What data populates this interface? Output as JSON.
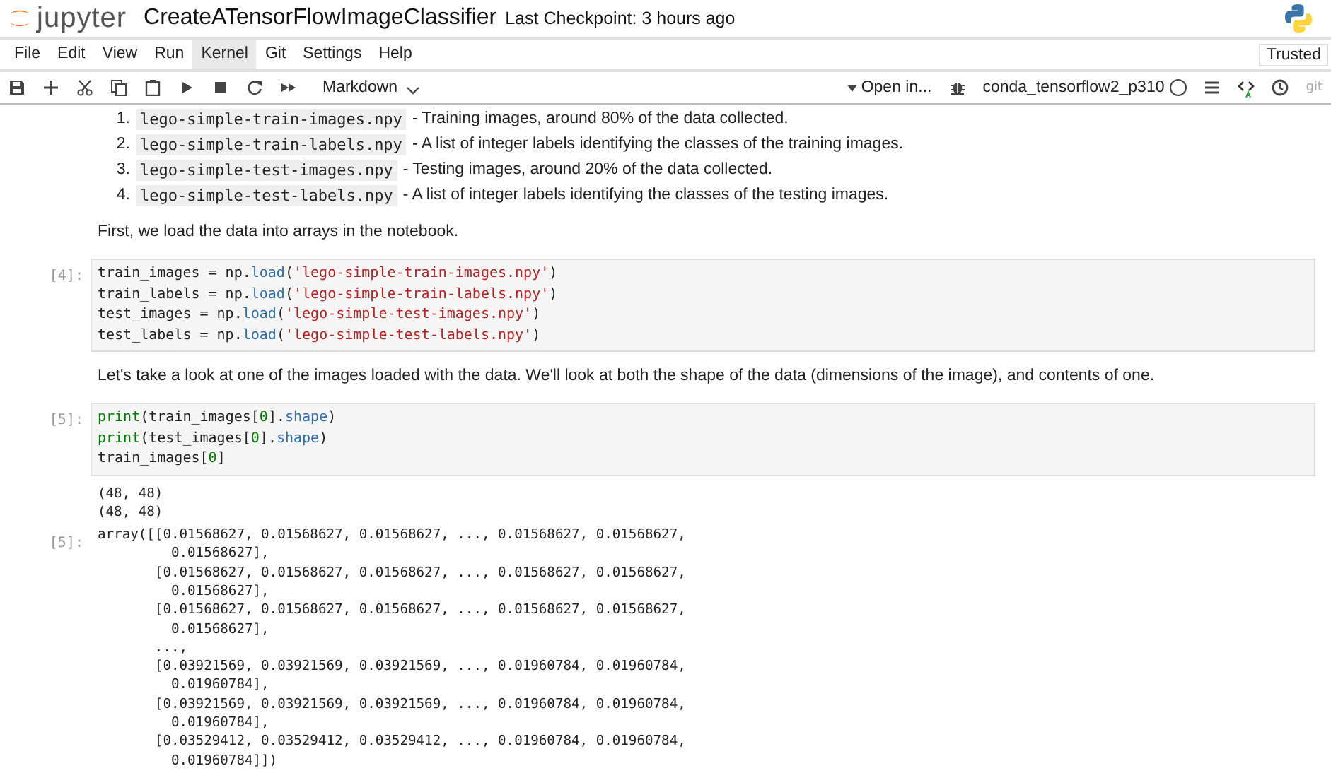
{
  "header": {
    "logo_text": "jupyter",
    "notebook_title": "CreateATensorFlowImageClassifier",
    "checkpoint": "Last Checkpoint: 3 hours ago"
  },
  "menu": [
    {
      "label": "File",
      "selected": false
    },
    {
      "label": "Edit",
      "selected": false
    },
    {
      "label": "View",
      "selected": false
    },
    {
      "label": "Run",
      "selected": false
    },
    {
      "label": "Kernel",
      "selected": true
    },
    {
      "label": "Git",
      "selected": false
    },
    {
      "label": "Settings",
      "selected": false
    },
    {
      "label": "Help",
      "selected": false
    }
  ],
  "trusted": "Trusted",
  "toolbar": {
    "cell_type": "Markdown",
    "open_in": "Open in...",
    "kernel": "conda_tensorflow2_p310",
    "kernel_busy": false,
    "git": "git"
  },
  "cells": [
    {
      "kind": "list",
      "items": [
        {
          "number": "1.",
          "code": "lego-simple-train-images.npy",
          "text": "- Training images, around 80% of the data collected."
        },
        {
          "number": "2.",
          "code": "lego-simple-train-labels.npy",
          "text": "- A list of integer labels identifying the classes of the training images."
        },
        {
          "number": "3.",
          "code": "lego-simple-test-images.npy",
          "text": "- Testing images, around 20% of the data collected."
        },
        {
          "number": "4.",
          "code": "lego-simple-test-labels.npy",
          "text": "- A list of integer labels identifying the classes of the testing images."
        }
      ]
    },
    {
      "kind": "paragraph",
      "text": "First, we load the data into arrays in the notebook."
    },
    {
      "kind": "code",
      "prompt": "[4]:",
      "lines": [
        [
          {
            "kind": "plain",
            "text": "train_images = np."
          },
          {
            "kind": "attr",
            "text": "load"
          },
          {
            "kind": "plain",
            "text": "("
          },
          {
            "kind": "string",
            "text": "'lego-simple-train-images.npy'"
          },
          {
            "kind": "plain",
            "text": ")"
          }
        ],
        [
          {
            "kind": "plain",
            "text": "train_labels = np."
          },
          {
            "kind": "attr",
            "text": "load"
          },
          {
            "kind": "plain",
            "text": "("
          },
          {
            "kind": "string",
            "text": "'lego-simple-train-labels.npy'"
          },
          {
            "kind": "plain",
            "text": ")"
          }
        ],
        [
          {
            "kind": "plain",
            "text": "test_images = np."
          },
          {
            "kind": "attr",
            "text": "load"
          },
          {
            "kind": "plain",
            "text": "("
          },
          {
            "kind": "string",
            "text": "'lego-simple-test-images.npy'"
          },
          {
            "kind": "plain",
            "text": ")"
          }
        ],
        [
          {
            "kind": "plain",
            "text": "test_labels = np."
          },
          {
            "kind": "attr",
            "text": "load"
          },
          {
            "kind": "plain",
            "text": "("
          },
          {
            "kind": "string",
            "text": "'lego-simple-test-labels.npy'"
          },
          {
            "kind": "plain",
            "text": ")"
          }
        ]
      ]
    },
    {
      "kind": "paragraph",
      "text": "Let's take a look at one of the images loaded with the data. We'll look at both the shape of the data (dimensions of the image), and contents of one."
    },
    {
      "kind": "code",
      "prompt": "[5]:",
      "lines": [
        [
          {
            "kind": "builtin",
            "text": "print"
          },
          {
            "kind": "plain",
            "text": "(train_images["
          },
          {
            "kind": "number",
            "text": "0"
          },
          {
            "kind": "plain",
            "text": "]."
          },
          {
            "kind": "attr",
            "text": "shape"
          },
          {
            "kind": "plain",
            "text": ")"
          }
        ],
        [
          {
            "kind": "builtin",
            "text": "print"
          },
          {
            "kind": "plain",
            "text": "(test_images["
          },
          {
            "kind": "number",
            "text": "0"
          },
          {
            "kind": "plain",
            "text": "]."
          },
          {
            "kind": "attr",
            "text": "shape"
          },
          {
            "kind": "plain",
            "text": ")"
          }
        ],
        [
          {
            "kind": "plain",
            "text": "train_images["
          },
          {
            "kind": "number",
            "text": "0"
          },
          {
            "kind": "plain",
            "text": "]"
          }
        ]
      ]
    },
    {
      "kind": "stream",
      "lines": [
        "(48, 48)",
        "(48, 48)"
      ]
    },
    {
      "kind": "result",
      "prompt": "[5]:",
      "lines": [
        "array([[0.01568627, 0.01568627, 0.01568627, ..., 0.01568627, 0.01568627,",
        "         0.01568627],",
        "       [0.01568627, 0.01568627, 0.01568627, ..., 0.01568627, 0.01568627,",
        "         0.01568627],",
        "       [0.01568627, 0.01568627, 0.01568627, ..., 0.01568627, 0.01568627,",
        "         0.01568627],",
        "       ...,",
        "       [0.03921569, 0.03921569, 0.03921569, ..., 0.01960784, 0.01960784,",
        "         0.01960784],",
        "       [0.03921569, 0.03921569, 0.03921569, ..., 0.01960784, 0.01960784,",
        "         0.01960784],",
        "       [0.03529412, 0.03529412, 0.03529412, ..., 0.01960784, 0.01960784,",
        "         0.01960784]])"
      ]
    }
  ]
}
